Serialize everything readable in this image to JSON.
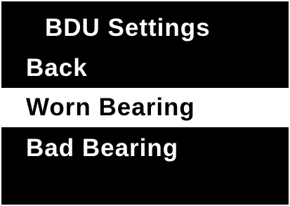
{
  "screen": {
    "title": "BDU Settings",
    "menu": {
      "items": [
        {
          "label": "Back",
          "selected": false
        },
        {
          "label": "Worn Bearing",
          "selected": true
        },
        {
          "label": "Bad Bearing",
          "selected": false
        }
      ]
    }
  },
  "colors": {
    "background": "#000000",
    "text": "#ffffff",
    "highlight_background": "#ffffff",
    "highlight_text": "#000000"
  }
}
